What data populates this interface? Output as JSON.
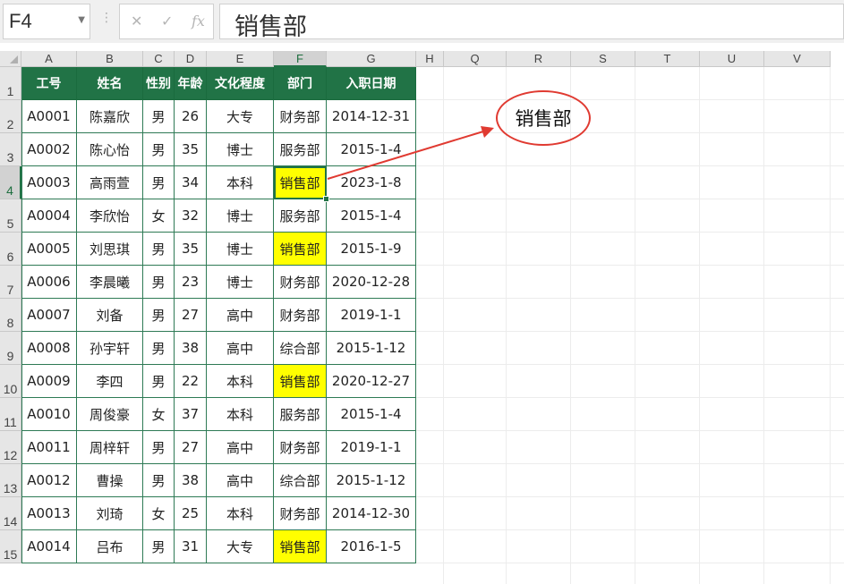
{
  "formula_bar": {
    "name_box": "F4",
    "cancel_icon": "✕",
    "confirm_icon": "✓",
    "fx_icon": "fx",
    "content": "销售部"
  },
  "columns": [
    "A",
    "B",
    "C",
    "D",
    "E",
    "F",
    "G",
    "H",
    "Q",
    "R",
    "S",
    "T",
    "U",
    "V"
  ],
  "rows": [
    "1",
    "2",
    "3",
    "4",
    "5",
    "6",
    "7",
    "8",
    "9",
    "10",
    "11",
    "12",
    "13",
    "14",
    "15"
  ],
  "active_cell": {
    "column": "F",
    "row": "4"
  },
  "table": {
    "headers": [
      "工号",
      "姓名",
      "性别",
      "年龄",
      "文化程度",
      "部门",
      "入职日期"
    ],
    "rows": [
      [
        "A0001",
        "陈嘉欣",
        "男",
        "26",
        "大专",
        "财务部",
        "2014-12-31"
      ],
      [
        "A0002",
        "陈心怡",
        "男",
        "35",
        "博士",
        "服务部",
        "2015-1-4"
      ],
      [
        "A0003",
        "高雨萱",
        "男",
        "34",
        "本科",
        "销售部",
        "2023-1-8"
      ],
      [
        "A0004",
        "李欣怡",
        "女",
        "32",
        "博士",
        "服务部",
        "2015-1-4"
      ],
      [
        "A0005",
        "刘思琪",
        "男",
        "35",
        "博士",
        "销售部",
        "2015-1-9"
      ],
      [
        "A0006",
        "李晨曦",
        "男",
        "23",
        "博士",
        "财务部",
        "2020-12-28"
      ],
      [
        "A0007",
        "刘备",
        "男",
        "27",
        "高中",
        "财务部",
        "2019-1-1"
      ],
      [
        "A0008",
        "孙宇轩",
        "男",
        "38",
        "高中",
        "综合部",
        "2015-1-12"
      ],
      [
        "A0009",
        "李四",
        "男",
        "22",
        "本科",
        "销售部",
        "2020-12-27"
      ],
      [
        "A0010",
        "周俊豪",
        "女",
        "37",
        "本科",
        "服务部",
        "2015-1-4"
      ],
      [
        "A0011",
        "周梓轩",
        "男",
        "27",
        "高中",
        "财务部",
        "2019-1-1"
      ],
      [
        "A0012",
        "曹操",
        "男",
        "38",
        "高中",
        "综合部",
        "2015-1-12"
      ],
      [
        "A0013",
        "刘琦",
        "女",
        "25",
        "本科",
        "财务部",
        "2014-12-30"
      ],
      [
        "A0014",
        "吕布",
        "男",
        "31",
        "大专",
        "销售部",
        "2016-1-5"
      ]
    ],
    "highlight_value": "销售部",
    "highlight_color": "#ffff00",
    "header_color": "#217346"
  },
  "annotation": {
    "label": "销售部",
    "circle_color": "#e03a31",
    "arrow_color": "#e03a31"
  }
}
